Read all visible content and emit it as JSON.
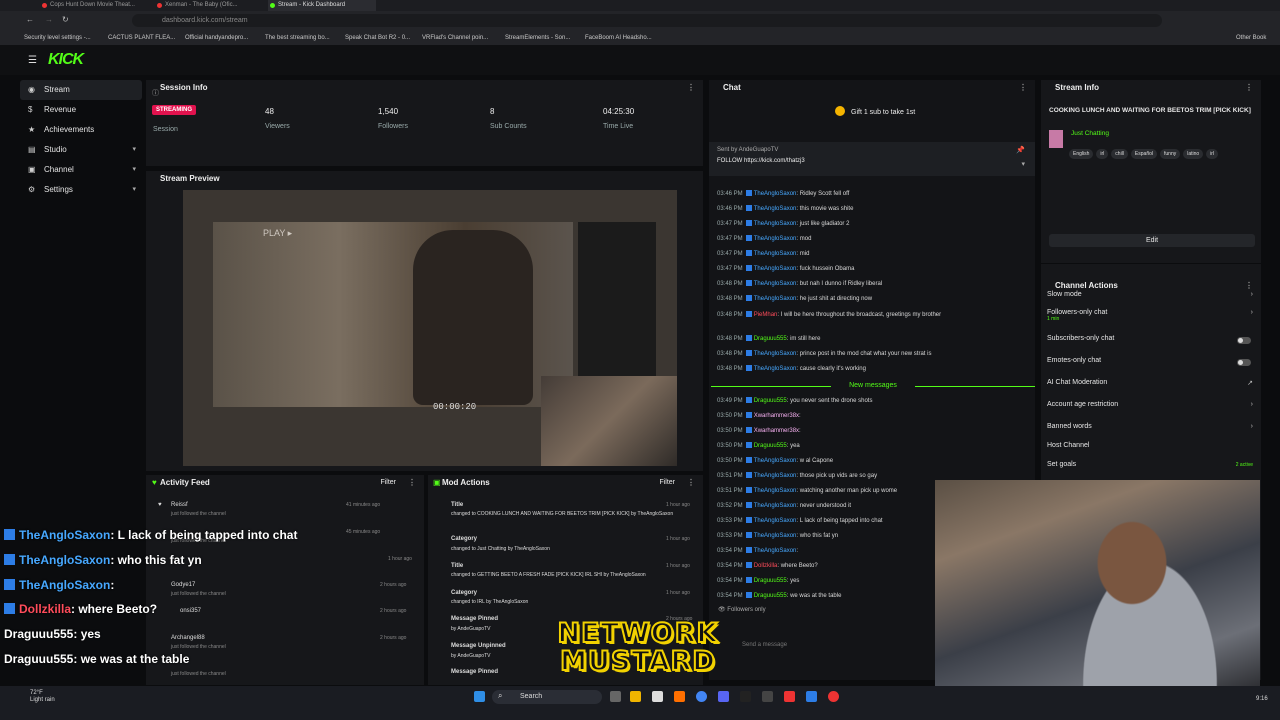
{
  "browser": {
    "tabs": [
      "Cops Hunt Down Movie Theat...",
      "Xenman - The Baby (Ofic...",
      "Stream - Kick Dashboard"
    ],
    "url": "dashboard.kick.com/stream",
    "bookmarks": [
      "Security level settings -...",
      "CACTUS PLANT FLEA...",
      "Official handyandepro...",
      "The best streaming bo...",
      "Speak Chat Bot R2 - 0...",
      "VRFlad's Channel poin...",
      "StreamElements - Son...",
      "FaceBoom AI Headsho..."
    ],
    "other_bookmarks": "Other Book"
  },
  "app": {
    "logo": "KICK"
  },
  "sidebar": {
    "items": [
      {
        "label": "Stream",
        "icon": "broadcast-icon"
      },
      {
        "label": "Revenue",
        "icon": "dollar-icon"
      },
      {
        "label": "Achievements",
        "icon": "trophy-icon"
      },
      {
        "label": "Studio",
        "icon": "layers-icon"
      },
      {
        "label": "Channel",
        "icon": "channel-icon"
      },
      {
        "label": "Settings",
        "icon": "gear-icon"
      }
    ]
  },
  "session": {
    "title": "Session Info",
    "badge": "STREAMING",
    "session_label": "Session",
    "viewers": "48",
    "viewers_label": "Viewers",
    "followers": "1,540",
    "followers_label": "Followers",
    "subs": "8",
    "subs_label": "Sub Counts",
    "time": "04:25:30",
    "time_label": "Time Live"
  },
  "preview": {
    "title": "Stream Preview",
    "timer": "00:00:20",
    "play": "PLAY ▸"
  },
  "activity": {
    "title": "Activity Feed",
    "filter": "Filter",
    "rows": [
      {
        "name": "Reissf",
        "action": "just followed the channel",
        "time": "41 minutes ago"
      },
      {
        "name": "",
        "action": "just followed the channel",
        "time": "45 minutes ago"
      },
      {
        "name": "",
        "action": "",
        "time": "1 hour ago"
      },
      {
        "name": "Godye17",
        "action": "just followed the channel",
        "time": "2 hours ago"
      },
      {
        "name": "onsi357",
        "action": "just followed the channel",
        "time": "2 hours ago"
      },
      {
        "name": "Archangel88",
        "action": "just followed the channel",
        "time": "2 hours ago"
      },
      {
        "name": "",
        "action": "just followed the channel",
        "time": ""
      }
    ]
  },
  "mod": {
    "title": "Mod Actions",
    "filter": "Filter",
    "rows": [
      {
        "label": "Title",
        "detail": "changed to COOKING LUNCH AND WAITING FOR BEETOS TRIM [PICK KICK] by TheAngloSaxon",
        "time": "1 hour ago"
      },
      {
        "label": "Category",
        "detail": "changed to Just Chatting by TheAngloSaxon",
        "time": "1 hour ago"
      },
      {
        "label": "Title",
        "detail": "changed to GETTING BEETO A FRESH FADE [PICK KICK] IRL SHI by TheAngloSaxon",
        "time": "1 hour ago"
      },
      {
        "label": "Category",
        "detail": "changed to IRL by TheAngloSaxon",
        "time": "1 hour ago"
      },
      {
        "label": "Message Pinned",
        "detail": "by AndeGuapoTV",
        "time": "2 hours ago"
      },
      {
        "label": "Message Unpinned",
        "detail": "by AndeGuapoTV",
        "time": ""
      },
      {
        "label": "Message Pinned",
        "detail": "",
        "time": ""
      }
    ]
  },
  "chat": {
    "title": "Chat",
    "gift": "Gift 1 sub to take 1st",
    "pinned_by": "Sent by AndeGuapoTV",
    "pinned_text": "FOLLOW https://kick.com/thatzj3",
    "new_messages": "New messages",
    "followers_only": "Followers only",
    "placeholder": "Send a message",
    "messages": [
      {
        "t": "03:46 PM",
        "u": "TheAngloSaxon",
        "c": "u",
        "m": "Ridley Scott fell off"
      },
      {
        "t": "03:46 PM",
        "u": "TheAngloSaxon",
        "c": "u",
        "m": "this movie was shite"
      },
      {
        "t": "03:47 PM",
        "u": "TheAngloSaxon",
        "c": "u",
        "m": "just like gladiator 2"
      },
      {
        "t": "03:47 PM",
        "u": "TheAngloSaxon",
        "c": "u",
        "m": "mod"
      },
      {
        "t": "03:47 PM",
        "u": "TheAngloSaxon",
        "c": "u",
        "m": "mid"
      },
      {
        "t": "03:47 PM",
        "u": "TheAngloSaxon",
        "c": "u",
        "m": "fuck hussein Obama"
      },
      {
        "t": "03:48 PM",
        "u": "TheAngloSaxon",
        "c": "u",
        "m": "but nah I dunno if Ridley liberal"
      },
      {
        "t": "03:48 PM",
        "u": "TheAngloSaxon",
        "c": "u",
        "m": "he just shit at directing now"
      },
      {
        "t": "03:48 PM",
        "u": "PieMhan",
        "c": "r",
        "m": "I will be here throughout the broadcast, greetings my brother"
      },
      {
        "t": "03:48 PM",
        "u": "Draguuu555",
        "c": "g",
        "m": "im still here"
      },
      {
        "t": "03:48 PM",
        "u": "TheAngloSaxon",
        "c": "u",
        "m": "prince post in the mod chat what your new strat is"
      },
      {
        "t": "03:48 PM",
        "u": "TheAngloSaxon",
        "c": "u",
        "m": "cause clearly it's working"
      },
      {
        "t": "03:49 PM",
        "u": "Draguuu555",
        "c": "g",
        "m": "you never sent the drone shots"
      },
      {
        "t": "03:50 PM",
        "u": "Xwarhammer38x",
        "c": "p",
        "m": ""
      },
      {
        "t": "03:50 PM",
        "u": "Xwarhammer38x",
        "c": "p",
        "m": ""
      },
      {
        "t": "03:50 PM",
        "u": "Draguuu555",
        "c": "g",
        "m": "yea"
      },
      {
        "t": "03:50 PM",
        "u": "TheAngloSaxon",
        "c": "u",
        "m": "w al Capone"
      },
      {
        "t": "03:51 PM",
        "u": "TheAngloSaxon",
        "c": "u",
        "m": "those pick up vids are so gay"
      },
      {
        "t": "03:51 PM",
        "u": "TheAngloSaxon",
        "c": "u",
        "m": "watching another man pick up wome"
      },
      {
        "t": "03:52 PM",
        "u": "TheAngloSaxon",
        "c": "u",
        "m": "never understood it"
      },
      {
        "t": "03:53 PM",
        "u": "TheAngloSaxon",
        "c": "u",
        "m": "L lack of being tapped into chat"
      },
      {
        "t": "03:53 PM",
        "u": "TheAngloSaxon",
        "c": "u",
        "m": "who this fat yn"
      },
      {
        "t": "03:54 PM",
        "u": "TheAngloSaxon",
        "c": "u",
        "m": ""
      },
      {
        "t": "03:54 PM",
        "u": "Dollzkilla",
        "c": "r",
        "m": "where Beeto?"
      },
      {
        "t": "03:54 PM",
        "u": "Draguuu555",
        "c": "g",
        "m": "yes"
      },
      {
        "t": "03:54 PM",
        "u": "Draguuu555",
        "c": "g",
        "m": "we was at the table"
      }
    ]
  },
  "stream_info": {
    "title": "Stream Info",
    "stream_title": "COOKING LUNCH AND WAITING FOR BEETOS TRIM [PICK KICK]",
    "category": "Just Chatting",
    "tags": [
      "English",
      "irl",
      "chill",
      "Español",
      "funny",
      "latino",
      "irl"
    ],
    "edit": "Edit"
  },
  "channel_actions": {
    "title": "Channel Actions",
    "rows": [
      {
        "label": "Slow mode",
        "sub": "",
        "control": "chevron"
      },
      {
        "label": "Followers-only chat",
        "sub": "1 min",
        "control": "chevron"
      },
      {
        "label": "Subscribers-only chat",
        "sub": "",
        "control": "toggle"
      },
      {
        "label": "Emotes-only chat",
        "sub": "",
        "control": "toggle"
      },
      {
        "label": "AI Chat Moderation",
        "sub": "",
        "control": "external"
      },
      {
        "label": "Account age restriction",
        "sub": "",
        "control": "chevron"
      },
      {
        "label": "Banned words",
        "sub": "",
        "control": "chevron"
      },
      {
        "label": "Host Channel",
        "sub": "",
        "control": "none"
      },
      {
        "label": "Set goals",
        "sub": "",
        "control": "active"
      }
    ],
    "goals_active": "2 active"
  },
  "overlay": {
    "lines": [
      {
        "u": "TheAngloSaxon",
        "m": ": L lack of being tapped into chat",
        "c": "u"
      },
      {
        "u": "TheAngloSaxon",
        "m": ": who this fat yn",
        "c": "u"
      },
      {
        "u": "TheAngloSaxon",
        "m": ":",
        "c": "u"
      },
      {
        "u": "Dollzkilla",
        "m": ": where Beeto?",
        "c": "r"
      },
      {
        "u": "Draguuu555",
        "m": ": yes",
        "c": "w"
      },
      {
        "u": "Draguuu555",
        "m": ": we was at the table",
        "c": "w"
      }
    ],
    "logo_line1": "NETWORK",
    "logo_line2": "MUSTARD"
  },
  "taskbar": {
    "weather_temp": "72°F",
    "weather_desc": "Light rain",
    "search": "Search",
    "time": "9:16"
  },
  "colors": {
    "brand": "#53fc18",
    "streaming": "#e2124e",
    "username": "#47a8ff"
  }
}
